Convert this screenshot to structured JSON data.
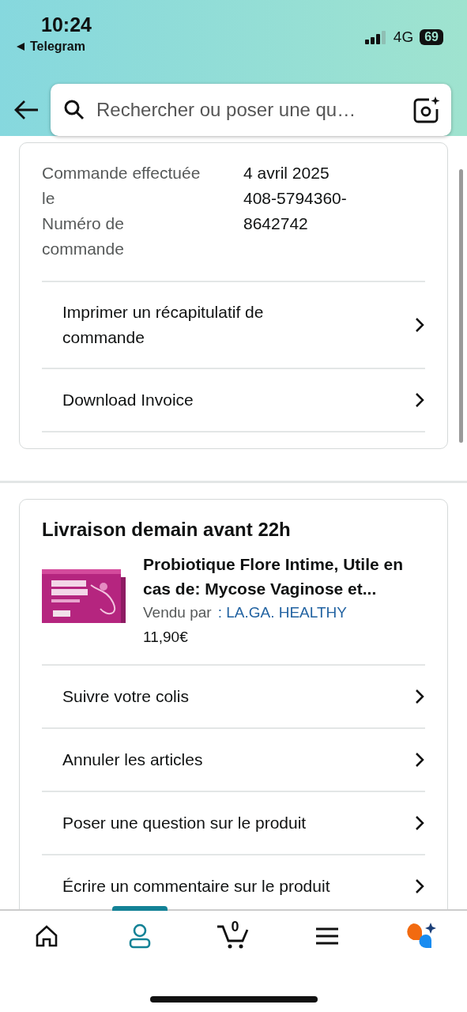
{
  "status_bar": {
    "time": "10:24",
    "back_app": "Telegram",
    "network": "4G",
    "battery": "69"
  },
  "search": {
    "placeholder": "Rechercher ou poser une qu…"
  },
  "order_info": {
    "fields": [
      {
        "label": "Commande effectuée le",
        "value": "4 avril 2025"
      },
      {
        "label": "Numéro de commande",
        "value": "408-5794360-8642742"
      }
    ],
    "actions": [
      "Imprimer un récapitulatif de commande",
      "Download Invoice"
    ]
  },
  "delivery": {
    "title": "Livraison demain avant 22h",
    "product": {
      "kind": "picture",
      "title": "Probiotique Flore Intime, Utile en cas de: Mycose Vaginose et...",
      "seller_label": "Vendu par",
      "seller": ": LA.GA. HEALTHY",
      "price": "11,90€"
    },
    "actions": [
      "Suivre votre colis",
      "Annuler les articles",
      "Poser une question sur le produit",
      "Écrire un commentaire sur le produit"
    ]
  },
  "bottom_nav": [
    {
      "kind": "home",
      "selected": false
    },
    {
      "kind": "account",
      "selected": true
    },
    {
      "kind": "cart",
      "selected": false,
      "count": "0"
    },
    {
      "kind": "menu",
      "selected": false
    },
    {
      "kind": "assistant",
      "selected": false
    }
  ]
}
